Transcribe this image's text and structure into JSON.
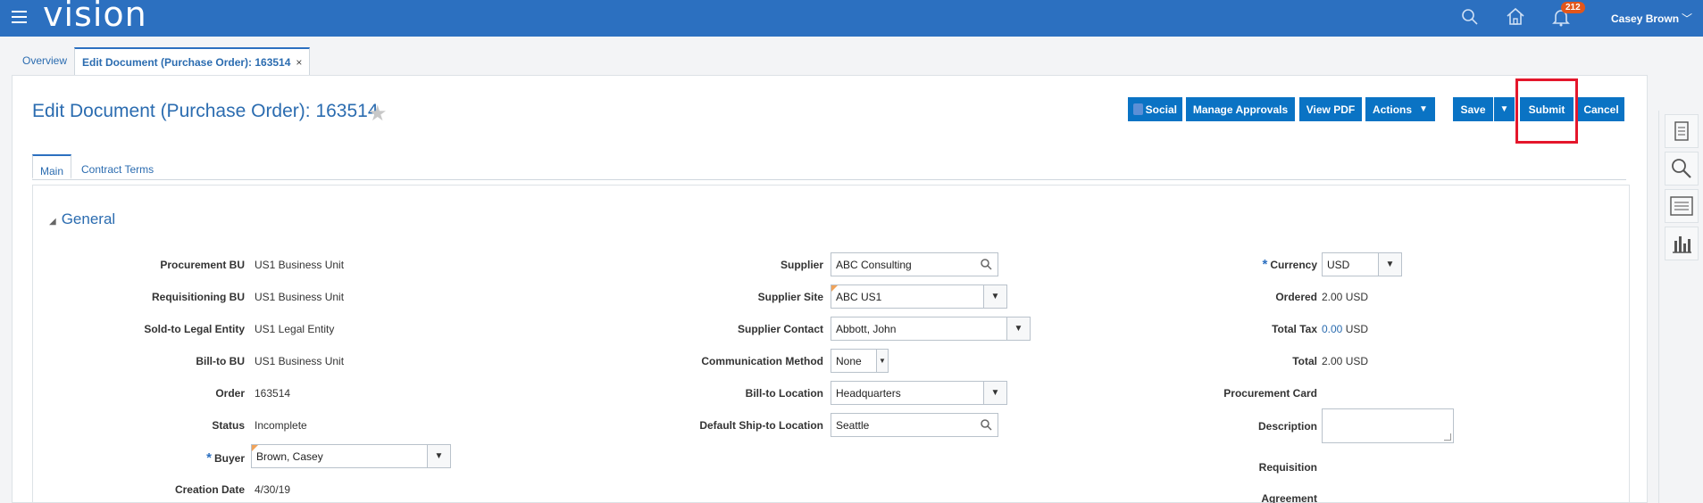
{
  "app": {
    "logo": "vision",
    "user": "Casey Brown",
    "notifications_count": "212"
  },
  "doc_tabs": [
    {
      "label": "Overview"
    },
    {
      "label": "Edit Document (Purchase Order): 163514",
      "close": "×"
    }
  ],
  "page": {
    "title": "Edit Document (Purchase Order): 163514"
  },
  "toolbar": {
    "social": "Social",
    "manage_approvals": "Manage Approvals",
    "view_pdf": "View PDF",
    "actions": "Actions",
    "save": "Save",
    "submit": "Submit",
    "cancel": "Cancel"
  },
  "tabs": [
    {
      "label": "Main"
    },
    {
      "label": "Contract Terms"
    }
  ],
  "section": {
    "title": "General"
  },
  "col1": [
    {
      "label": "Procurement BU",
      "value": "US1 Business Unit"
    },
    {
      "label": "Requisitioning BU",
      "value": "US1 Business Unit"
    },
    {
      "label": "Sold-to Legal Entity",
      "value": "US1 Legal Entity"
    },
    {
      "label": "Bill-to BU",
      "value": "US1 Business Unit"
    },
    {
      "label": "Order",
      "value": "163514"
    },
    {
      "label": "Status",
      "value": "Incomplete"
    },
    {
      "label": "Buyer",
      "value": "Brown, Casey"
    },
    {
      "label": "Creation Date",
      "value": "4/30/19"
    }
  ],
  "col2": [
    {
      "label": "Supplier",
      "value": "ABC Consulting"
    },
    {
      "label": "Supplier Site",
      "value": "ABC US1"
    },
    {
      "label": "Supplier Contact",
      "value": "Abbott, John"
    },
    {
      "label": "Communication Method",
      "value": "None"
    },
    {
      "label": "Bill-to Location",
      "value": "Headquarters"
    },
    {
      "label": "Default Ship-to Location",
      "value": "Seattle"
    }
  ],
  "col3": [
    {
      "label": "Currency",
      "value": "USD"
    },
    {
      "label": "Ordered",
      "value": "2.00",
      "unit": "USD"
    },
    {
      "label": "Total Tax",
      "value": "0.00",
      "unit": "USD"
    },
    {
      "label": "Total",
      "value": "2.00",
      "unit": "USD"
    },
    {
      "label": "Procurement Card",
      "value": ""
    },
    {
      "label": "Description",
      "value": ""
    },
    {
      "label": "Requisition",
      "value": ""
    },
    {
      "label": "Agreement",
      "value": ""
    }
  ]
}
